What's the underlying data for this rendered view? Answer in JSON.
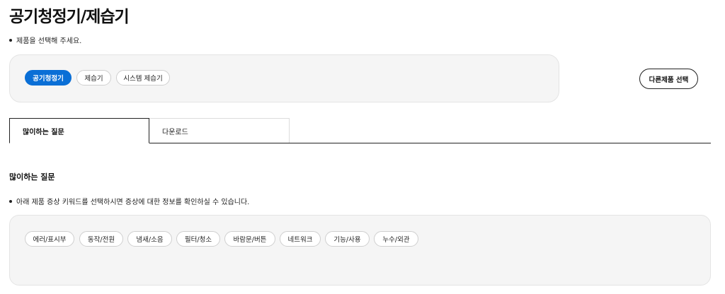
{
  "page": {
    "title": "공기청정기/제습기"
  },
  "product_select": {
    "note": "제품을 선택해 주세요.",
    "chips": [
      {
        "label": "공기청정기",
        "active": true
      },
      {
        "label": "제습기",
        "active": false
      },
      {
        "label": "시스템 제습기",
        "active": false
      }
    ],
    "other_button": "다른제품 선택"
  },
  "tabs": [
    {
      "label": "많이하는 질문",
      "active": true
    },
    {
      "label": "다운로드",
      "active": false
    }
  ],
  "faq": {
    "title": "많이하는 질문",
    "note": "아래 제품 증상 키워드를 선택하시면 증상에 대한 정보를 확인하실 수 있습니다.",
    "keywords": [
      "에러/표시부",
      "동작/전원",
      "냄새/소음",
      "필터/청소",
      "바람문/버튼",
      "네트워크",
      "기능/사용",
      "누수/외관"
    ]
  },
  "colors": {
    "accent": "#0a6fd6",
    "panel": "#f5f5f5"
  }
}
